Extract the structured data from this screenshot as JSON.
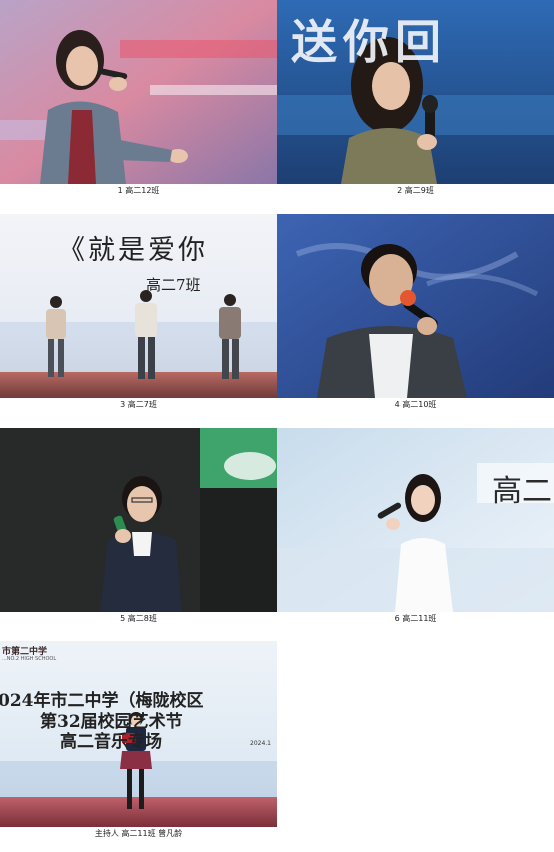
{
  "photos": [
    {
      "caption": "1 高二12班"
    },
    {
      "caption": "2 高二9班",
      "screen_text": "送你回"
    },
    {
      "caption": "3 高二7班",
      "screen_title": "《就是爱你",
      "screen_subtitle": "高二7班"
    },
    {
      "caption": "4 高二10班"
    },
    {
      "caption": "5 高二8班"
    },
    {
      "caption": "6 高二11班",
      "screen_text": "高二"
    },
    {
      "caption": "主持人 高二11班 曾凡龄",
      "school_logo_text": "市第二中学",
      "school_logo_small": "...NO.2 HIGH SCHOOL",
      "screen_line1": "024年市二中学（梅陇校区",
      "screen_line2": "第32届校园艺术节",
      "screen_line3": "高二音乐专场",
      "screen_date": "2024.1"
    }
  ]
}
